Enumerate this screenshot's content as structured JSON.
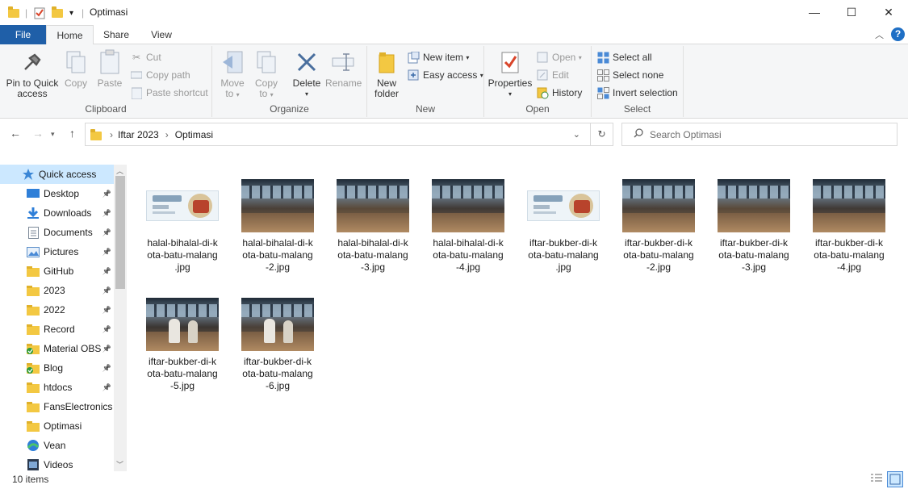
{
  "window": {
    "title": "Optimasi",
    "minimize_glyph": "—",
    "maximize_glyph": "☐",
    "close_glyph": "✕"
  },
  "ribbon_tabs": {
    "file": "File",
    "home": "Home",
    "share": "Share",
    "view": "View"
  },
  "ribbon": {
    "clipboard": {
      "label": "Clipboard",
      "pin_line1": "Pin to Quick",
      "pin_line2": "access",
      "copy": "Copy",
      "paste": "Paste",
      "cut": "Cut",
      "copy_path": "Copy path",
      "paste_shortcut": "Paste shortcut"
    },
    "organize": {
      "label": "Organize",
      "move_to_1": "Move",
      "move_to_2": "to",
      "copy_to_1": "Copy",
      "copy_to_2": "to",
      "delete": "Delete",
      "rename": "Rename"
    },
    "new": {
      "label": "New",
      "new_folder_1": "New",
      "new_folder_2": "folder",
      "new_item": "New item",
      "easy_access": "Easy access"
    },
    "open": {
      "label": "Open",
      "properties": "Properties",
      "open": "Open",
      "edit": "Edit",
      "history": "History"
    },
    "select": {
      "label": "Select",
      "select_all": "Select all",
      "select_none": "Select none",
      "invert_selection": "Invert selection"
    }
  },
  "address": {
    "crumbs": [
      "Iftar 2023",
      "Optimasi"
    ],
    "search_placeholder": "Search Optimasi"
  },
  "sidebar": {
    "items": [
      {
        "label": "Quick access",
        "icon": "star-icon",
        "pinned": false,
        "selected": true
      },
      {
        "label": "Desktop",
        "icon": "desktop-icon",
        "pinned": true
      },
      {
        "label": "Downloads",
        "icon": "download-icon",
        "pinned": true
      },
      {
        "label": "Documents",
        "icon": "document-icon",
        "pinned": true
      },
      {
        "label": "Pictures",
        "icon": "pictures-icon",
        "pinned": true
      },
      {
        "label": "GitHub",
        "icon": "folder-icon",
        "pinned": true
      },
      {
        "label": "2023",
        "icon": "folder-icon",
        "pinned": true
      },
      {
        "label": "2022",
        "icon": "folder-icon",
        "pinned": true
      },
      {
        "label": "Record",
        "icon": "folder-icon",
        "pinned": true
      },
      {
        "label": "Material OBS",
        "icon": "folder-sync-icon",
        "pinned": true
      },
      {
        "label": "Blog",
        "icon": "folder-sync-icon",
        "pinned": true
      },
      {
        "label": "htdocs",
        "icon": "folder-icon",
        "pinned": true
      },
      {
        "label": "FansElectronics",
        "icon": "folder-icon",
        "pinned": false
      },
      {
        "label": "Optimasi",
        "icon": "folder-icon",
        "pinned": false
      },
      {
        "label": "Vean",
        "icon": "onedrive-icon",
        "pinned": false
      },
      {
        "label": "Videos",
        "icon": "videos-icon",
        "pinned": false
      }
    ]
  },
  "files": [
    {
      "line1": "halal-bihalal-di-k",
      "line2": "ota-batu-malang",
      "line3": ".jpg",
      "kind": "card"
    },
    {
      "line1": "halal-bihalal-di-k",
      "line2": "ota-batu-malang",
      "line3": "-2.jpg",
      "kind": "photo"
    },
    {
      "line1": "halal-bihalal-di-k",
      "line2": "ota-batu-malang",
      "line3": "-3.jpg",
      "kind": "photo"
    },
    {
      "line1": "halal-bihalal-di-k",
      "line2": "ota-batu-malang",
      "line3": "-4.jpg",
      "kind": "photo"
    },
    {
      "line1": "iftar-bukber-di-k",
      "line2": "ota-batu-malang",
      "line3": ".jpg",
      "kind": "card"
    },
    {
      "line1": "iftar-bukber-di-k",
      "line2": "ota-batu-malang",
      "line3": "-2.jpg",
      "kind": "photo"
    },
    {
      "line1": "iftar-bukber-di-k",
      "line2": "ota-batu-malang",
      "line3": "-3.jpg",
      "kind": "photo"
    },
    {
      "line1": "iftar-bukber-di-k",
      "line2": "ota-batu-malang",
      "line3": "-4.jpg",
      "kind": "photo"
    },
    {
      "line1": "iftar-bukber-di-k",
      "line2": "ota-batu-malang",
      "line3": "-5.jpg",
      "kind": "photo-people"
    },
    {
      "line1": "iftar-bukber-di-k",
      "line2": "ota-batu-malang",
      "line3": "-6.jpg",
      "kind": "photo-people"
    }
  ],
  "status": {
    "item_count": "10 items"
  },
  "colors": {
    "accent": "#1f5fa8",
    "selection": "#cce8ff",
    "folder": "#f3c842"
  }
}
